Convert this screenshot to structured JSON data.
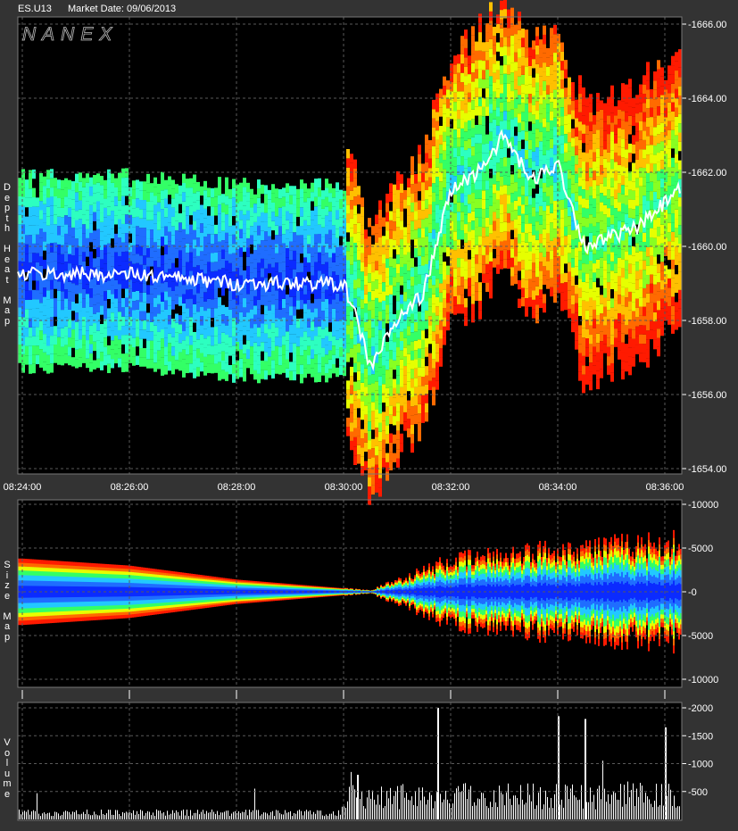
{
  "header": {
    "symbol": "ES.U13",
    "market_date": "Market Date: 09/06/2013"
  },
  "watermark": "NANEX",
  "colors": {
    "background": "#333333",
    "plot_bg": "#000000",
    "grid": "#5a5a5a",
    "axis_text": "#ffffff",
    "price_trace": "#ffffff",
    "volume_bars": "#ffffff",
    "heat_scale": [
      "#0b2bff",
      "#1f6dff",
      "#22c8ff",
      "#2dffc0",
      "#33ff66",
      "#88ff22",
      "#e6ff00",
      "#ffc000",
      "#ff6a00",
      "#ff1a00"
    ]
  },
  "chart_data": [
    {
      "type": "heatmap",
      "name": "depth-heat-map",
      "panel_label": "Depth Heat Map",
      "x_ticks": [
        "08:24:00",
        "08:26:00",
        "08:28:00",
        "08:30:00",
        "08:32:00",
        "08:34:00",
        "08:36:00"
      ],
      "y_ticks": [
        "-1666.00",
        "-1664.00",
        "-1662.00",
        "-1660.00",
        "-1658.00",
        "-1656.00",
        "-1654.00"
      ],
      "ylim": [
        1653.75,
        1666.25
      ],
      "grid": true,
      "price_trace": {
        "x": [
          "08:24:00",
          "08:26:00",
          "08:28:00",
          "08:30:00",
          "08:30:15",
          "08:30:30",
          "08:31:00",
          "08:31:30",
          "08:32:00",
          "08:32:30",
          "08:33:00",
          "08:33:30",
          "08:34:00",
          "08:34:30",
          "08:35:00",
          "08:35:30",
          "08:36:15"
        ],
        "y": [
          1659.25,
          1659.25,
          1659.0,
          1659.0,
          1658.0,
          1656.75,
          1658.0,
          1658.75,
          1661.5,
          1662.0,
          1663.0,
          1661.75,
          1662.25,
          1660.0,
          1660.25,
          1660.5,
          1661.5
        ]
      }
    },
    {
      "type": "area",
      "name": "size-map",
      "panel_label": "Size Map",
      "y_ticks": [
        "-10000",
        "-5000",
        "-0",
        "-5000",
        "-10000"
      ],
      "ylim": [
        -10000,
        10000
      ],
      "grid": true,
      "x": [
        "08:24:00",
        "08:26:00",
        "08:28:00",
        "08:30:00",
        "08:30:30",
        "08:32:00",
        "08:34:00",
        "08:36:15"
      ],
      "half_width": [
        3800,
        3000,
        1400,
        400,
        200,
        3800,
        5200,
        6000
      ]
    },
    {
      "type": "bar",
      "name": "volume",
      "panel_label": "Volume",
      "y_ticks": [
        "-2000",
        "-1500",
        "-1000",
        "-500"
      ],
      "ylim": [
        0,
        2000
      ],
      "grid": true,
      "baseline": "low before 08:30:00, elevated after",
      "spikes": [
        {
          "x": "08:30:15",
          "y": 800
        },
        {
          "x": "08:31:45",
          "y": 2000
        },
        {
          "x": "08:34:00",
          "y": 1850
        },
        {
          "x": "08:34:30",
          "y": 1800
        },
        {
          "x": "08:36:00",
          "y": 1650
        }
      ]
    }
  ]
}
